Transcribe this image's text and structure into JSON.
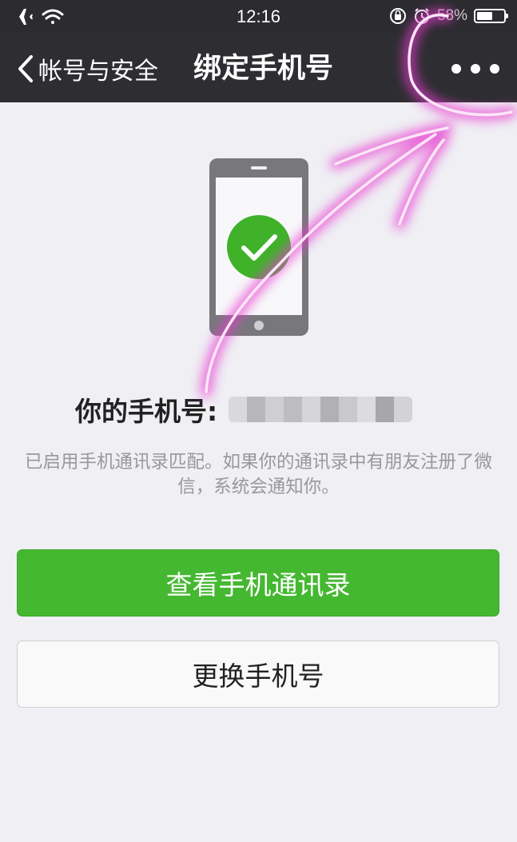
{
  "status_bar": {
    "time": "12:16",
    "battery_percent": "58%",
    "battery_level": 0.58,
    "icons": [
      "airplane-icon",
      "wifi-icon",
      "orientation-lock-icon",
      "alarm-icon",
      "battery-icon"
    ]
  },
  "nav": {
    "back_label": "帐号与安全",
    "title": "绑定手机号",
    "more_icon": "more-dots-icon"
  },
  "content": {
    "phone_number_label": "你的手机号:",
    "phone_number_value": "",
    "description": "已启用手机通讯录匹配。如果你的通讯录中有朋友注册了微信，系统会通知你。",
    "illustration_icon": "phone-check-icon"
  },
  "buttons": {
    "view_contacts": "查看手机通讯录",
    "change_number": "更换手机号"
  },
  "colors": {
    "nav_background": "#2e2e32",
    "primary_green": "#45b831",
    "check_green": "#3fb22a",
    "annotation_magenta": "#e83ad0",
    "page_background": "#efeff4"
  }
}
